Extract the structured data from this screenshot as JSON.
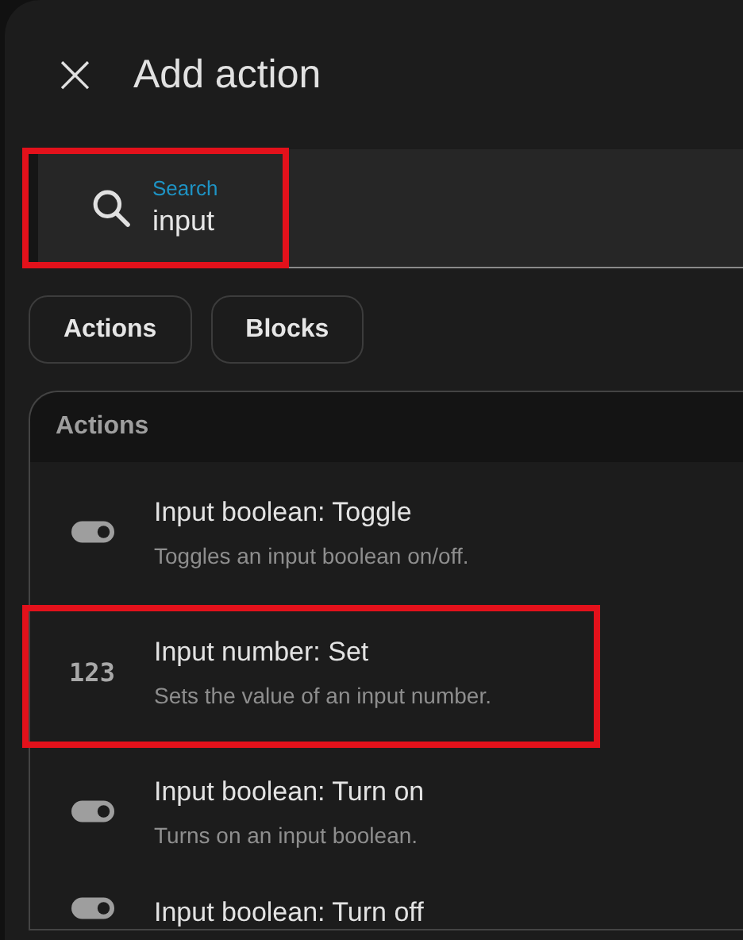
{
  "dialog": {
    "title": "Add action",
    "close_icon": "×"
  },
  "search": {
    "label": "Search",
    "value": "input",
    "highlighted": true
  },
  "filters": [
    {
      "label": "Actions",
      "selected": false
    },
    {
      "label": "Blocks",
      "selected": false
    }
  ],
  "section": {
    "title": "Actions",
    "items": [
      {
        "kind": "toggle",
        "title": "Input boolean: Toggle",
        "description": "Toggles an input boolean on/off.",
        "highlighted": false
      },
      {
        "kind": "number",
        "icon_text": "123",
        "title": "Input number: Set",
        "description": "Sets the value of an input number.",
        "highlighted": true
      },
      {
        "kind": "toggle",
        "title": "Input boolean: Turn on",
        "description": "Turns on an input boolean.",
        "highlighted": false
      },
      {
        "kind": "toggle",
        "title": "Input boolean: Turn off",
        "highlighted": false
      }
    ]
  }
}
